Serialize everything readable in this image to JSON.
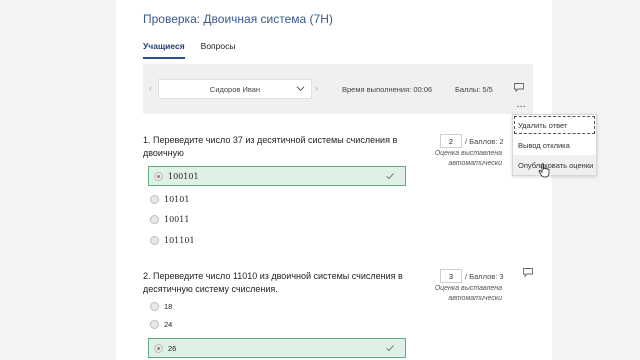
{
  "header": {
    "title": "Проверка: Двоичная система (7H)"
  },
  "tabs": [
    {
      "label": "Учащиеся",
      "active": true
    },
    {
      "label": "Вопросы",
      "active": false
    }
  ],
  "toolbar": {
    "student_name": "Сидоров Иван",
    "time_label": "Время выполнения: 00:06",
    "score_label": "Баллы: 5/5",
    "prev_arrow": "‹",
    "next_arrow": "›",
    "more_label": "..."
  },
  "menu": {
    "items": [
      "Удалить ответ",
      "Вывод отклика",
      "Опубликовать оценки"
    ]
  },
  "questions": [
    {
      "text": "1. Переведите число 37 из десятичной системы счисления в двоичную",
      "points_value": "2",
      "points_label": "/ Баллов: 2",
      "auto_note": "Оценка выставлена автоматически",
      "options": [
        "100101",
        "10101",
        "10011",
        "101101"
      ],
      "selected_index": 0
    },
    {
      "text": "2. Переведите число 11010 из двоичной системы счисления в десятичную систему счисления.",
      "points_value": "3",
      "points_label": "/ Баллов: 3",
      "auto_note": "Оценка выставлена автоматически",
      "options": [
        "18",
        "24",
        "26"
      ],
      "selected_index": 2
    }
  ],
  "colors": {
    "accent": "#2b4f86",
    "correct_bg": "#dff0e6",
    "correct_border": "#5fae80"
  }
}
